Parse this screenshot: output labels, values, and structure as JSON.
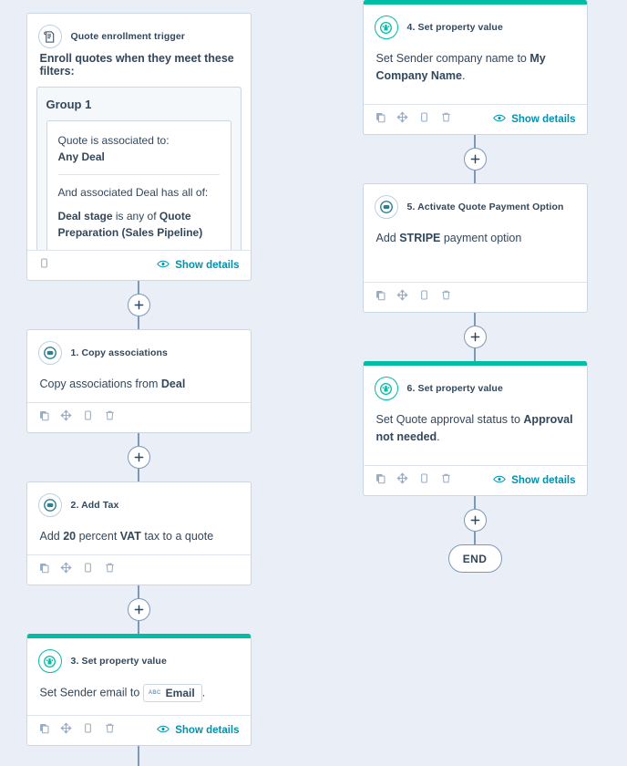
{
  "theme": {
    "background": "#eaeef7",
    "card_bg": "#ffffff",
    "border": "#cbd6e2",
    "text": "#33475b",
    "link": "#0091ae",
    "accent_green": "#00bda5",
    "accent_teal": "#2e7f92",
    "connector": "#7c98b6"
  },
  "common": {
    "show_details": "Show details",
    "plus_label": "+",
    "icons": {
      "duplicate": "duplicate-icon",
      "move": "move-icon",
      "clone": "clone-icon",
      "delete": "trash-icon",
      "eye": "eye-icon",
      "plus": "plus-icon"
    }
  },
  "trigger": {
    "title": "Quote enrollment trigger",
    "icon": "quote-document-icon",
    "lead": "Enroll quotes when they meet these filters:",
    "group": {
      "title": "Group 1",
      "conditions": [
        {
          "prefix": "Quote is associated to:",
          "value": "Any Deal"
        },
        {
          "prefix": "And associated Deal has all of:",
          "property": "Deal stage",
          "operator": " is any of ",
          "value": "Quote Preparation (Sales Pipeline)"
        }
      ]
    },
    "footer": {
      "show_details": false,
      "icons": [
        "clone-icon"
      ]
    }
  },
  "actions": [
    {
      "number": "1.",
      "title": "1. Copy associations",
      "icon": "quote-object-icon",
      "icon_style": "teal",
      "green_bar": false,
      "body_parts": [
        {
          "text": "Copy associations from ",
          "bold": false
        },
        {
          "text": "Deal",
          "bold": true
        }
      ],
      "show_details": false,
      "column": "left"
    },
    {
      "number": "2.",
      "title": "2. Add Tax",
      "icon": "quote-object-icon",
      "icon_style": "teal",
      "green_bar": false,
      "body_parts": [
        {
          "text": "Add ",
          "bold": false
        },
        {
          "text": "20",
          "bold": true
        },
        {
          "text": " percent ",
          "bold": false
        },
        {
          "text": "VAT",
          "bold": true
        },
        {
          "text": " tax to a quote",
          "bold": false
        }
      ],
      "show_details": false,
      "column": "left"
    },
    {
      "number": "3.",
      "title": "3. Set property value",
      "icon": "contacts-people-icon",
      "icon_style": "green",
      "green_bar": true,
      "body_parts": [
        {
          "text": "Set Sender email to ",
          "bold": false
        },
        {
          "token": "Email",
          "token_kind": "abc"
        },
        {
          "text": ".",
          "bold": false
        }
      ],
      "show_details": true,
      "column": "left"
    },
    {
      "number": "4.",
      "title": "4. Set property value",
      "icon": "contacts-people-icon",
      "icon_style": "green",
      "green_bar": true,
      "body_parts": [
        {
          "text": "Set Sender company name to ",
          "bold": false
        },
        {
          "text": "My Company Name",
          "bold": true
        },
        {
          "text": ".",
          "bold": false
        }
      ],
      "show_details": true,
      "column": "right"
    },
    {
      "number": "5.",
      "title": "5. Activate Quote Payment Option",
      "icon": "quote-object-icon",
      "icon_style": "teal",
      "green_bar": false,
      "body_parts": [
        {
          "text": "Add ",
          "bold": false
        },
        {
          "text": "STRIPE",
          "bold": true
        },
        {
          "text": " payment option",
          "bold": false
        }
      ],
      "show_details": false,
      "column": "right"
    },
    {
      "number": "6.",
      "title": "6. Set property value",
      "icon": "contacts-people-icon",
      "icon_style": "green",
      "green_bar": true,
      "body_parts": [
        {
          "text": "Set Quote approval status to ",
          "bold": false
        },
        {
          "text": "Approval not needed",
          "bold": true
        },
        {
          "text": ".",
          "bold": false
        }
      ],
      "show_details": true,
      "column": "right"
    }
  ],
  "end_node": {
    "label": "END"
  }
}
